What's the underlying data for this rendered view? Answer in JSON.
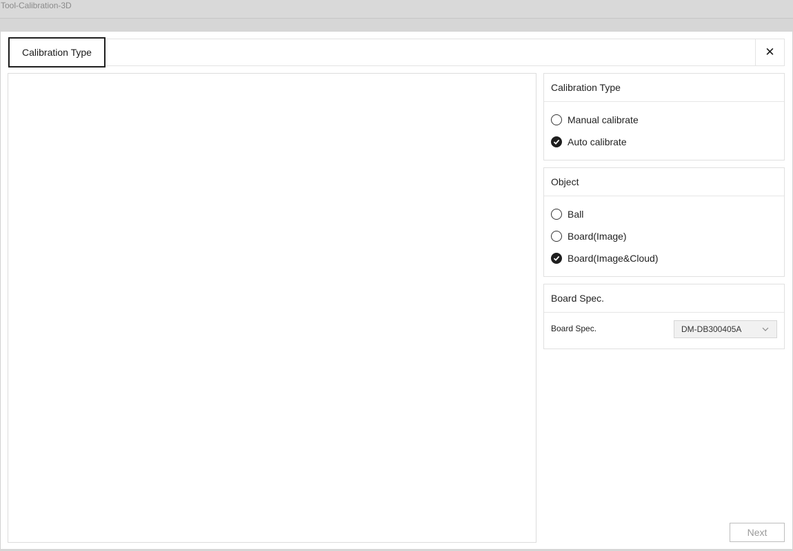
{
  "window": {
    "title": "Tool-Calibration-3D"
  },
  "tabs": {
    "active_label": "Calibration Type"
  },
  "close": {
    "icon": "close-icon"
  },
  "calibration_type": {
    "header": "Calibration Type",
    "options": [
      {
        "label": "Manual calibrate",
        "checked": false
      },
      {
        "label": "Auto calibrate",
        "checked": true
      }
    ]
  },
  "object": {
    "header": "Object",
    "options": [
      {
        "label": "Ball",
        "checked": false
      },
      {
        "label": "Board(Image)",
        "checked": false
      },
      {
        "label": "Board(Image&Cloud)",
        "checked": true
      }
    ]
  },
  "board_spec": {
    "header": "Board Spec.",
    "field_label": "Board Spec.",
    "selected_value": "DM-DB300405A"
  },
  "footer": {
    "next_label": "Next"
  }
}
